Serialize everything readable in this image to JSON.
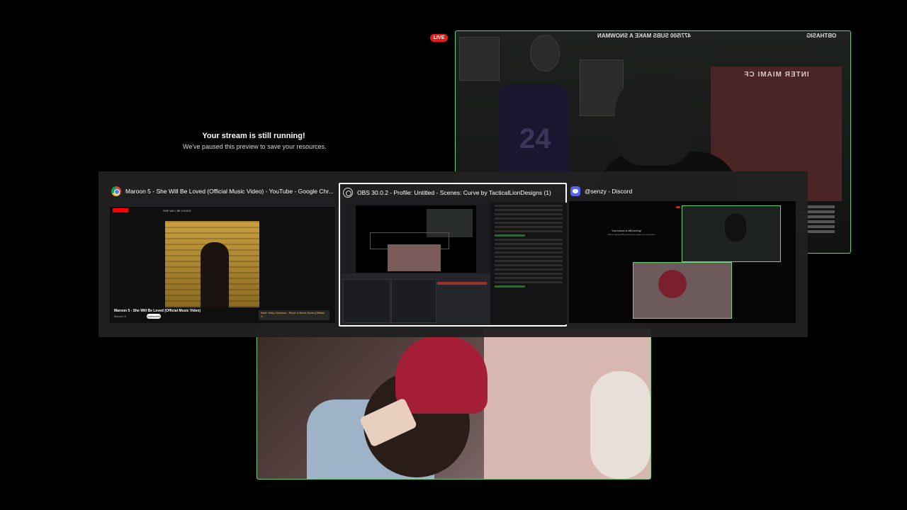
{
  "preview": {
    "title": "Your stream is still running!",
    "subtitle": "We've paused this preview to save your resources."
  },
  "live_badge": "LIVE",
  "webcam_top": {
    "overlay_left": "477/500 SUBS MAKE A SNOWMAN",
    "overlay_right": "OBTHASIG",
    "jersey_number": "24",
    "banner_text": "INTER MIAMI CF"
  },
  "task_switcher": {
    "windows": [
      {
        "title": "Maroon 5 - She Will Be Loved (Official Music Video) - YouTube - Google Chr...",
        "icon": "chrome-icon",
        "content": {
          "search_query": "SHE WILL BE LOVED",
          "video_title": "Maroon 5 - She Will Be Loved (Official Music Video)",
          "channel": "Maroon 5",
          "subscribe": "Subscribe",
          "next": "Next: Kelly Clarkson - Since U Been Gone (Official V..."
        }
      },
      {
        "title": "OBS 30.0.2 - Profile: Untitled - Scenes: Curve by TacticalLionDesigns (1)",
        "icon": "obs-icon",
        "selected": true
      },
      {
        "title": "@senzy - Discord",
        "icon": "discord-icon",
        "content": {
          "msg_title": "Your stream is still running!",
          "msg_sub": "We've paused this preview to save your resources."
        }
      }
    ]
  },
  "colors": {
    "live": "#e91916",
    "cam_border": "#6fcf7a",
    "switcher_bg": "#202020"
  }
}
